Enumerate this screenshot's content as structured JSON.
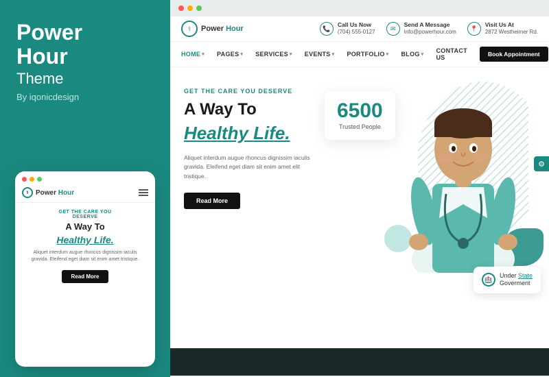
{
  "left": {
    "brand_line1": "Power",
    "brand_line2": "Hour",
    "brand_subtitle": "Theme",
    "brand_by": "By iqonicdesign"
  },
  "mobile": {
    "logo_text1": "Power",
    "logo_text2": " Hour",
    "tagline": "GET THE CARE YOU\nDESERVE",
    "h1": "A Way To",
    "h2": "Healthy Life.",
    "desc": "Aliquet interdum augue rhoncus dignissim iaculis gravida. Eleifend eget diam sit enim amet tristique.",
    "read_more": "Read More"
  },
  "website": {
    "logo_text1": "Power",
    "logo_text2": " Hour",
    "contact": {
      "call_label": "Call Us Now",
      "call_number": "(704) 555-0127",
      "msg_label": "Send A Message",
      "msg_email": "Info@powerhour.com",
      "visit_label": "Visit Us At",
      "visit_addr": "2872 Westheimer Rd."
    },
    "nav": {
      "items": [
        "HOME",
        "PAGES",
        "SERVICES",
        "EVENTS",
        "PORTFOLIO",
        "BLOG",
        "CONTACT US"
      ],
      "book_btn": "Book Appointment"
    },
    "hero": {
      "tagline": "GET THE CARE YOU DESERVE",
      "h1": "A Way To",
      "h2": "Healthy Life.",
      "desc": "Aliquet interdum augue rhoncus dignissim iaculis gravida. Eleifend eget diam sit enim amet elit tristique.",
      "read_more": "Read More",
      "stats_number": "6500",
      "stats_label": "Trusted People",
      "gov_text1": "Under",
      "gov_link": "State",
      "gov_text2": "Goverment"
    }
  }
}
